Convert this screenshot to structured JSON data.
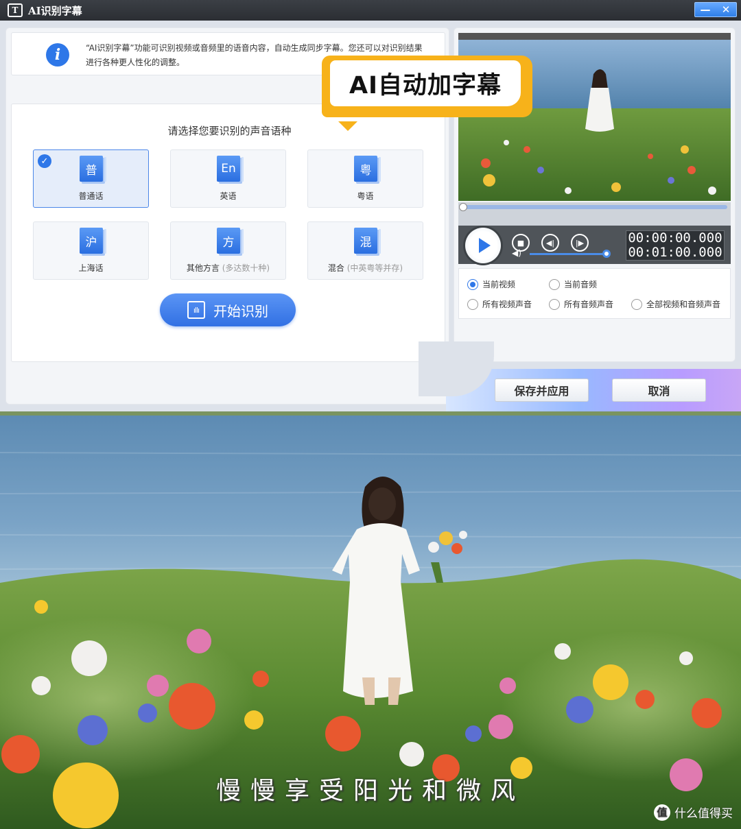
{
  "window": {
    "title": "AI识别字幕",
    "logo_text": "T",
    "minimize_glyph": "—",
    "close_glyph": "✕"
  },
  "info": {
    "icon": "info-icon",
    "text": "“AI识别字幕”功能可识别视频或音频里的语音内容，自动生成同步字幕。您还可以对识别结果进行各种更人性化的调整。"
  },
  "callout": {
    "text": "AI自动加字幕"
  },
  "language_panel": {
    "heading": "请选择您要识别的声音语种",
    "selected": "普通话",
    "options": [
      {
        "glyph": "普",
        "label": "普通话",
        "note": ""
      },
      {
        "glyph": "En",
        "label": "英语",
        "note": ""
      },
      {
        "glyph": "粤",
        "label": "粤语",
        "note": ""
      },
      {
        "glyph": "沪",
        "label": "上海话",
        "note": ""
      },
      {
        "glyph": "方",
        "label": "其他方言",
        "note": "(多达数十种)"
      },
      {
        "glyph": "混",
        "label": "混合",
        "note": "(中英粤等并存)"
      }
    ],
    "start_button": "开始识别"
  },
  "player": {
    "current_time": "00:00:00.000",
    "total_time": "00:01:00.000",
    "progress": 0,
    "volume": 0.95
  },
  "source_options": {
    "selected": "当前视频",
    "items": [
      "当前视频",
      "当前音频",
      "所有视频声音",
      "所有音频声音",
      "全部视频和音频声音"
    ]
  },
  "actions": {
    "save": "保存并应用",
    "cancel": "取消"
  },
  "scene": {
    "subtitle": "慢慢享受阳光和微风",
    "watermark": "什么值得买",
    "watermark_badge": "值"
  },
  "colors": {
    "accent": "#2e77e8",
    "callout": "#f7b21a",
    "titlebar": "#2b2e33"
  }
}
